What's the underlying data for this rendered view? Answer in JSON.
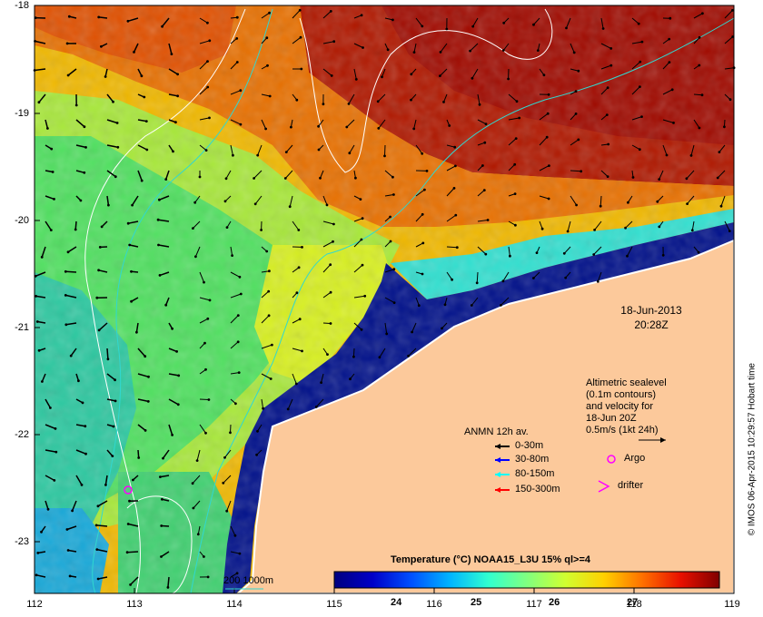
{
  "map": {
    "date": "18-Jun-2013",
    "time": "20:28Z",
    "credit": "© IMOS 06-Apr-2015 10:29:57 Hobart time",
    "lat_labels": [
      "-18",
      "-19",
      "-20",
      "-21",
      "-22",
      "-23"
    ],
    "lon_labels": [
      "112",
      "113",
      "114",
      "115",
      "116",
      "117",
      "118",
      "119"
    ],
    "sealevel_note": [
      "Altimetric sealevel",
      "(0.1m contours)",
      "and velocity for",
      "18-Jun 20Z",
      "0.5m/s (1kt 24h)"
    ],
    "legend": {
      "title": "ANMN 12h av.",
      "items": [
        {
          "label": "0-30m",
          "color": "#000000"
        },
        {
          "label": "30-80m",
          "color": "#0000ff"
        },
        {
          "label": "80-150m",
          "color": "#00ffff"
        },
        {
          "label": "150-300m",
          "color": "#ff0000"
        }
      ],
      "argo": "Argo",
      "drifter": "drifter"
    },
    "bathymetry_label": "200  1000m",
    "colorbar": {
      "title": "Temperature (°C) NOAA15_L3U 15% ql>=4",
      "ticks": [
        "24",
        "25",
        "26",
        "27"
      ],
      "min": 23.3,
      "max": 27.7,
      "colors": [
        "#00007f",
        "#0000c8",
        "#0050ff",
        "#00b4ff",
        "#30ffd0",
        "#80ff80",
        "#d0ff30",
        "#ffd000",
        "#ff7000",
        "#e81000",
        "#800000"
      ]
    },
    "land_color": "#fcc99b"
  }
}
